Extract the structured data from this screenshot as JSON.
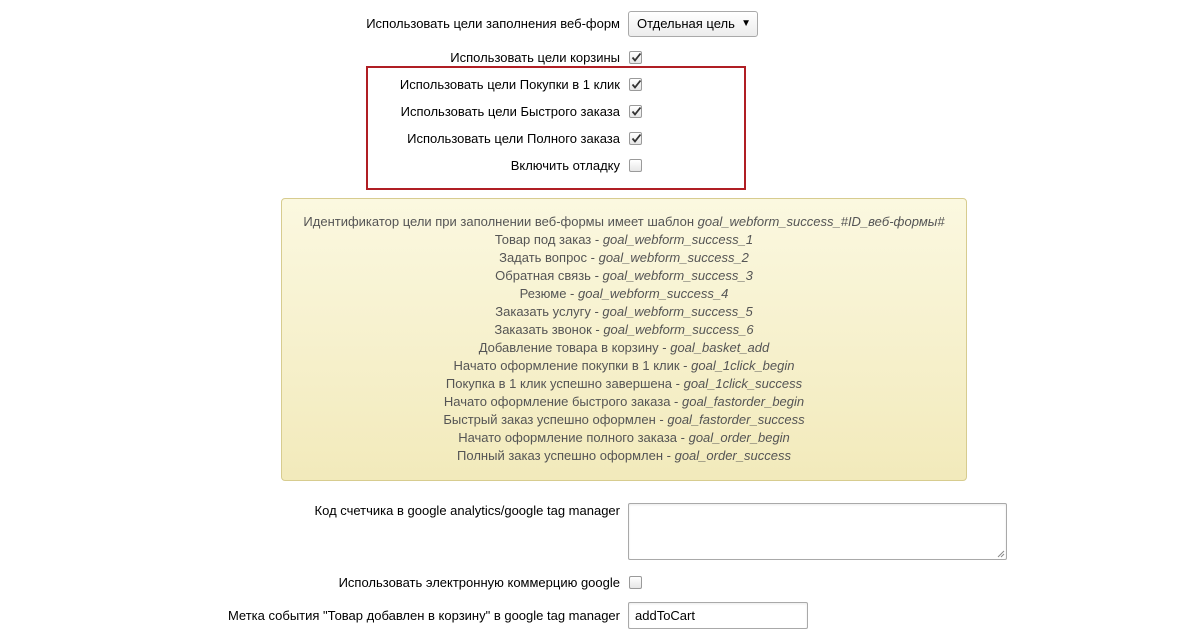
{
  "webforms": {
    "label": "Использовать цели заполнения веб-форм",
    "select_value": "Отдельная цель"
  },
  "basket": {
    "label": "Использовать цели корзины",
    "checked": true
  },
  "oneclick": {
    "label": "Использовать цели Покупки в 1 клик",
    "checked": true
  },
  "fastorder": {
    "label": "Использовать цели Быстрого заказа",
    "checked": true
  },
  "fullorder": {
    "label": "Использовать цели Полного заказа",
    "checked": true
  },
  "debug": {
    "label": "Включить отладку",
    "checked": false
  },
  "note": {
    "lines": [
      {
        "text": "Идентификатор цели при заполнении веб-формы имеет шаблон ",
        "goal": "goal_webform_success_#ID_веб-формы#"
      },
      {
        "text": "Товар под заказ - ",
        "goal": "goal_webform_success_1"
      },
      {
        "text": "Задать вопрос - ",
        "goal": "goal_webform_success_2"
      },
      {
        "text": "Обратная связь - ",
        "goal": "goal_webform_success_3"
      },
      {
        "text": "Резюме - ",
        "goal": "goal_webform_success_4"
      },
      {
        "text": "Заказать услугу - ",
        "goal": "goal_webform_success_5"
      },
      {
        "text": "Заказать звонок - ",
        "goal": "goal_webform_success_6"
      },
      {
        "text": "Добавление товара в корзину - ",
        "goal": "goal_basket_add"
      },
      {
        "text": "Начато оформление покупки в 1 клик - ",
        "goal": "goal_1click_begin"
      },
      {
        "text": "Покупка в 1 клик успешно завершена - ",
        "goal": "goal_1click_success"
      },
      {
        "text": "Начато оформление быстрого заказа - ",
        "goal": "goal_fastorder_begin"
      },
      {
        "text": "Быстрый заказ успешно оформлен - ",
        "goal": "goal_fastorder_success"
      },
      {
        "text": "Начато оформление полного заказа - ",
        "goal": "goal_order_begin"
      },
      {
        "text": "Полный заказ успешно оформлен - ",
        "goal": "goal_order_success"
      }
    ]
  },
  "counter": {
    "label": "Код счетчика в google analytics/google tag manager",
    "value": ""
  },
  "ecommerce": {
    "label": "Использовать электронную коммерцию google",
    "checked": false
  },
  "event_label": {
    "label": "Метка события \"Товар добавлен в корзину\" в google tag manager",
    "value": "addToCart"
  }
}
